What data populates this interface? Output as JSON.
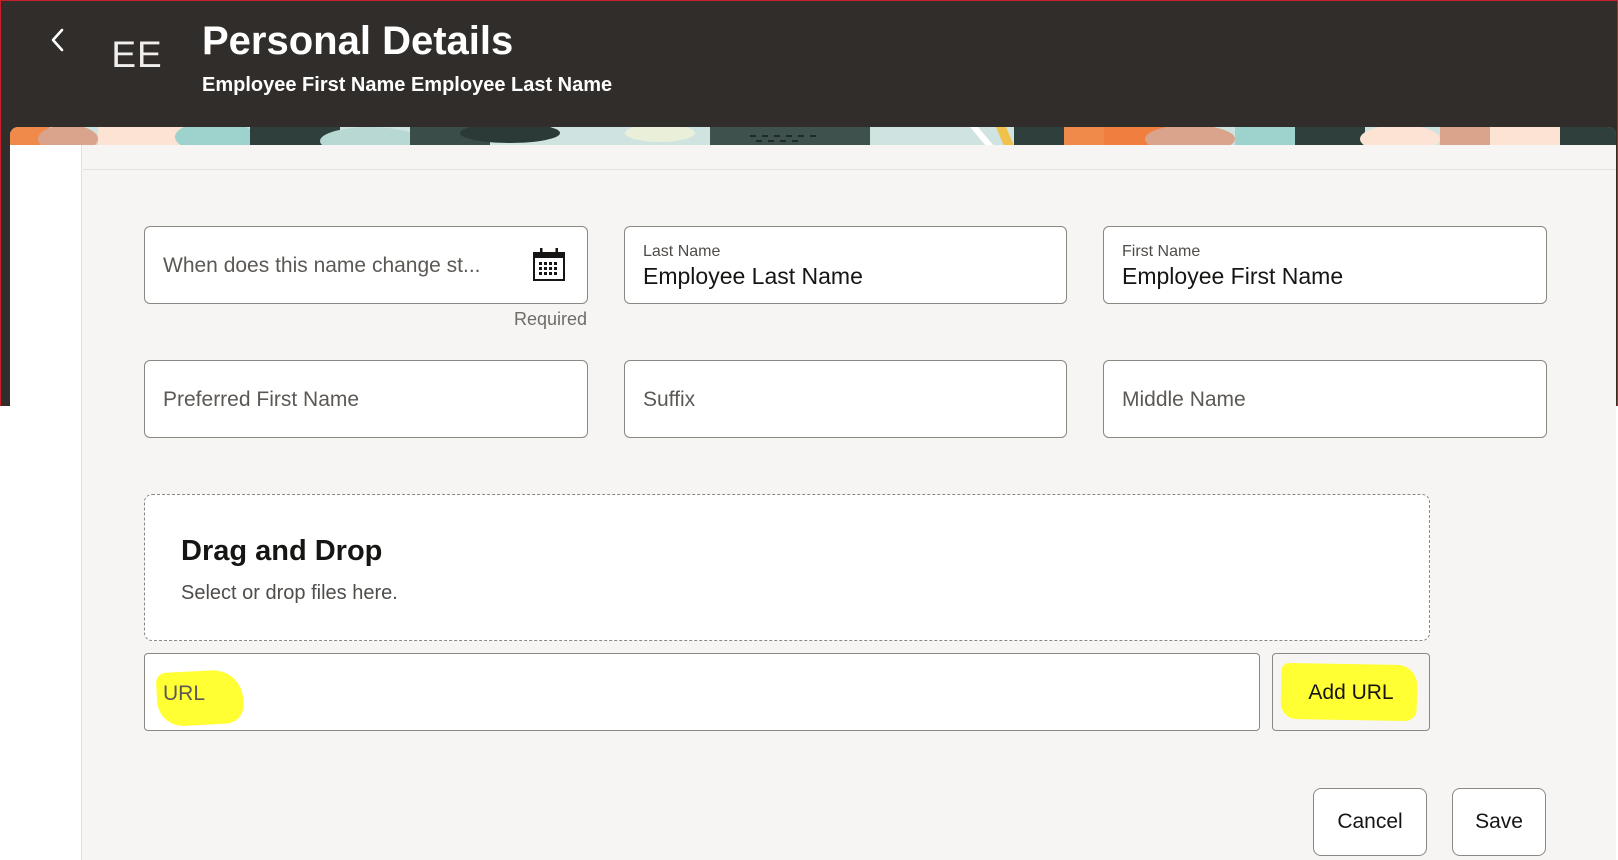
{
  "header": {
    "title": "Personal Details",
    "subtitle": "Employee First Name Employee Last Name",
    "avatar_initials": "EE",
    "background_color": "#312d2a"
  },
  "form": {
    "effective_date": {
      "placeholder": "When does this name change st...",
      "helper": "Required"
    },
    "last_name": {
      "label": "Last Name",
      "value": "Employee Last Name"
    },
    "first_name": {
      "label": "First Name",
      "value": "Employee First Name"
    },
    "preferred_first_name": {
      "placeholder": "Preferred First Name"
    },
    "suffix": {
      "placeholder": "Suffix"
    },
    "middle_name": {
      "placeholder": "Middle Name"
    }
  },
  "attachments": {
    "dropzone_title": "Drag and Drop",
    "dropzone_subtitle": "Select or drop files here.",
    "url_placeholder": "URL",
    "add_url_label": "Add URL",
    "highlight_color": "#ffff33"
  },
  "footer": {
    "cancel_label": "Cancel",
    "save_label": "Save"
  },
  "icons": {
    "back": "chevron-left-icon",
    "calendar": "calendar-icon"
  }
}
